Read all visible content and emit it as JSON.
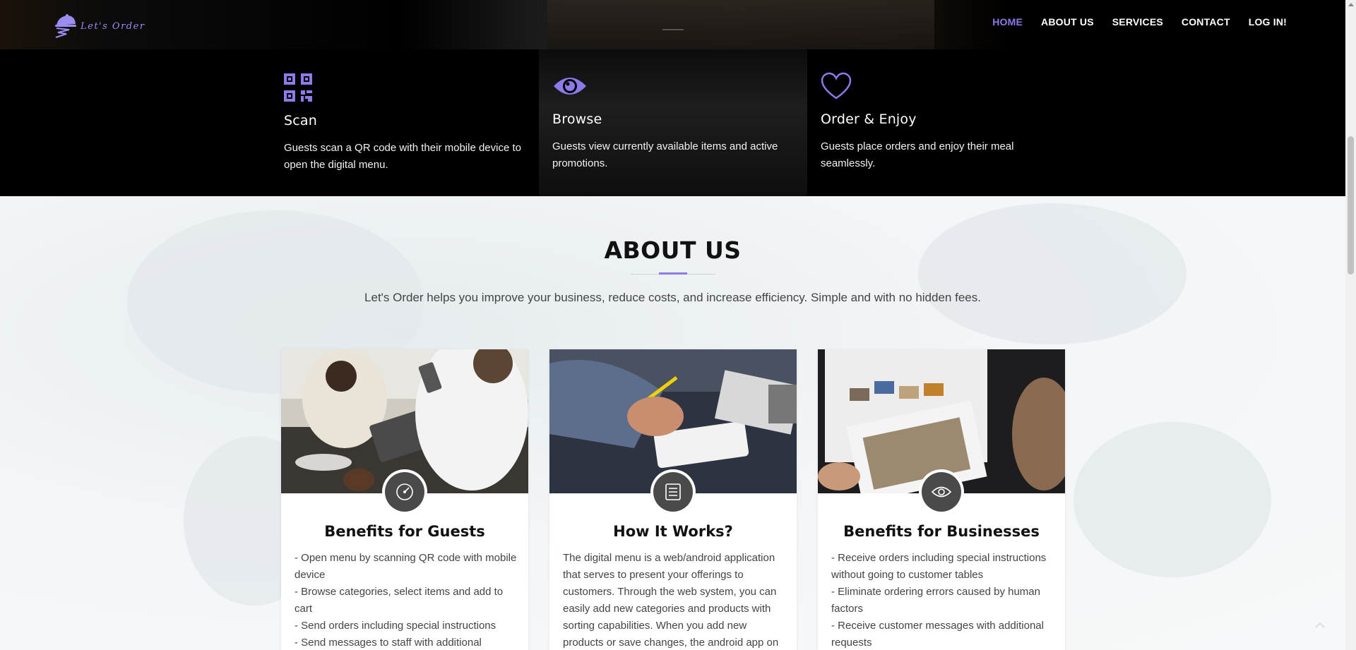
{
  "brand": {
    "name": "Let's Order"
  },
  "nav": [
    {
      "label": "HOME",
      "active": true
    },
    {
      "label": "ABOUT US",
      "active": false
    },
    {
      "label": "SERVICES",
      "active": false
    },
    {
      "label": "CONTACT",
      "active": false
    },
    {
      "label": "LOG IN!",
      "active": false
    }
  ],
  "features": [
    {
      "icon": "qr-code-icon",
      "title": "Scan",
      "text": "Guests scan a QR code with their mobile device to open the digital menu."
    },
    {
      "icon": "eye-icon",
      "title": "Browse",
      "text": "Guests view currently available items and active promotions."
    },
    {
      "icon": "heart-icon",
      "title": "Order & Enjoy",
      "text": "Guests place orders and enjoy their meal seamlessly."
    }
  ],
  "about": {
    "title": "ABOUT US",
    "subtitle": "Let's Order helps you improve your business, reduce costs, and increase efficiency. Simple and with no hidden fees."
  },
  "cards": [
    {
      "icon": "dashboard-icon",
      "title": "Benefits for Guests",
      "lines": [
        "- Open menu by scanning QR code with mobile device",
        "- Browse categories, select items and add to cart",
        "- Send orders including special instructions",
        "- Send messages to staff with additional"
      ]
    },
    {
      "icon": "list-icon",
      "title": "How It Works?",
      "lines": [
        "The digital menu is a web/android application that serves to present your offerings to customers. Through the web system, you can easily add new categories and products with sorting capabilities. When you add new products or save changes, the android app on"
      ]
    },
    {
      "icon": "eye-icon",
      "title": "Benefits for Businesses",
      "lines": [
        "- Receive orders including special instructions without going to customer tables",
        "- Eliminate ordering errors caused by human factors",
        "- Receive customer messages with additional requests"
      ]
    }
  ],
  "colors": {
    "accent": "#8b7ae8",
    "dark": "#000000",
    "text": "#444444"
  }
}
